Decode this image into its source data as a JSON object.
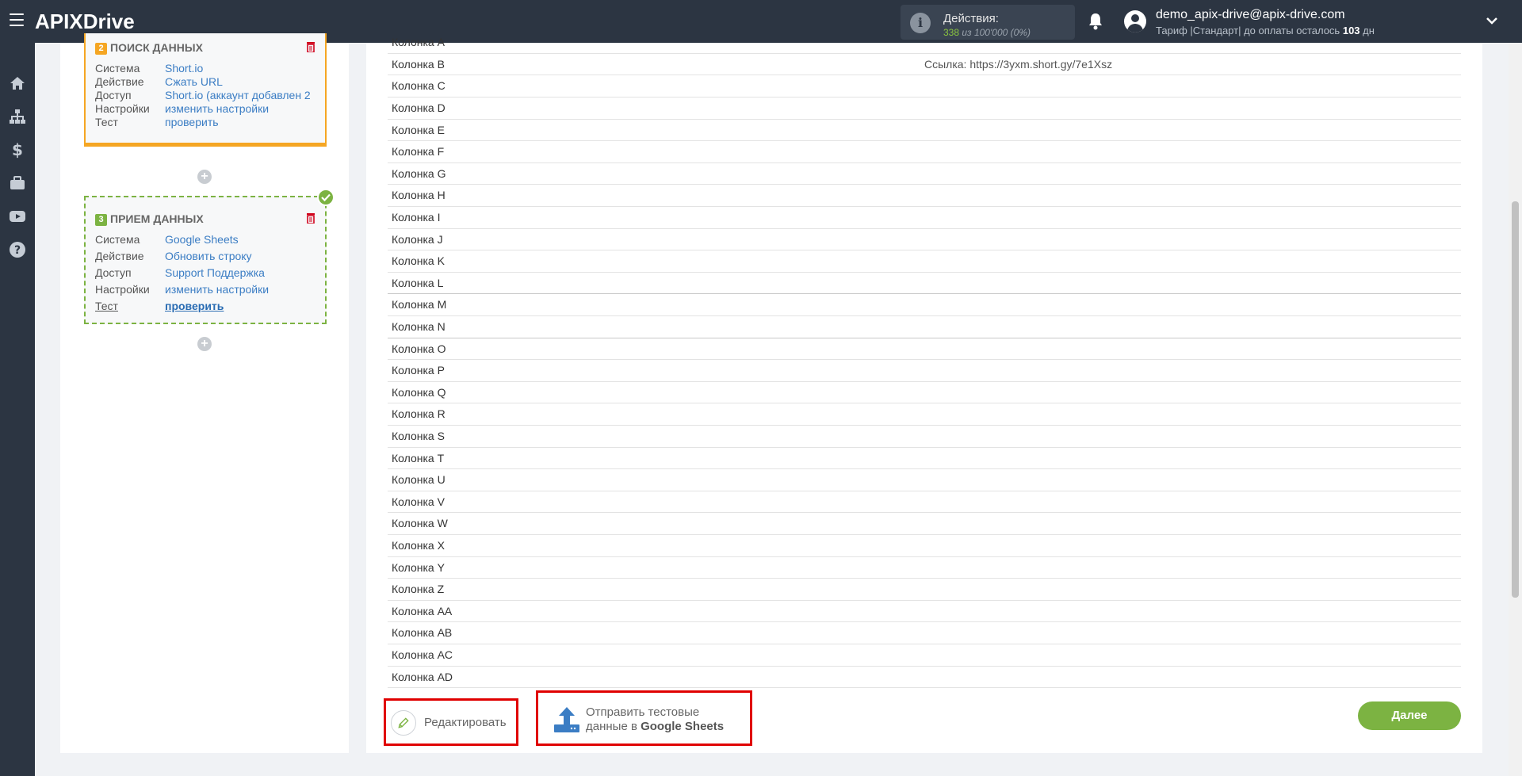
{
  "header": {
    "logo_api": "APIX",
    "logo_drive": "Drive",
    "actions_label": "Действия:",
    "actions_used": "338",
    "actions_rest": "из 100'000 (0%)",
    "user_email": "demo_apix-drive@apix-drive.com",
    "plan_prefix": "Тариф |Стандарт| до оплаты осталось",
    "plan_days": "103",
    "plan_suffix": "дн"
  },
  "sidebar": {
    "icons": [
      "home-icon",
      "sitemap-icon",
      "dollar-icon",
      "briefcase-icon",
      "youtube-icon",
      "help-icon"
    ]
  },
  "search_card": {
    "num": "2",
    "title": "ПОИСК ДАННЫХ",
    "rows": [
      {
        "k": "Система",
        "v": "Short.io"
      },
      {
        "k": "Действие",
        "v": "Сжать URL"
      },
      {
        "k": "Доступ",
        "v": "Short.io (аккаунт добавлен 2"
      },
      {
        "k": "Настройки",
        "v": "изменить настройки"
      },
      {
        "k": "Тест",
        "v": "проверить"
      }
    ]
  },
  "recv_card": {
    "num": "3",
    "title": "ПРИЕМ ДАННЫХ",
    "rows": [
      {
        "k": "Система",
        "v": "Google Sheets"
      },
      {
        "k": "Действие",
        "v": "Обновить строку"
      },
      {
        "k": "Доступ",
        "v": "Support Поддержка"
      },
      {
        "k": "Настройки",
        "v": "изменить настройки"
      },
      {
        "k": "Тест",
        "v": "проверить"
      }
    ]
  },
  "table": {
    "rows": [
      {
        "col": "Колонка A",
        "val": ""
      },
      {
        "col": "Колонка B",
        "val": "Ссылка: https://3yxm.short.gy/7e1Xsz"
      },
      {
        "col": "Колонка C",
        "val": ""
      },
      {
        "col": "Колонка D",
        "val": ""
      },
      {
        "col": "Колонка E",
        "val": ""
      },
      {
        "col": "Колонка F",
        "val": ""
      },
      {
        "col": "Колонка G",
        "val": ""
      },
      {
        "col": "Колонка H",
        "val": ""
      },
      {
        "col": "Колонка I",
        "val": ""
      },
      {
        "col": "Колонка J",
        "val": ""
      },
      {
        "col": "Колонка K",
        "val": ""
      },
      {
        "col": "Колонка L",
        "val": ""
      },
      {
        "col": "Колонка M",
        "val": ""
      },
      {
        "col": "Колонка N",
        "val": ""
      },
      {
        "col": "Колонка O",
        "val": ""
      },
      {
        "col": "Колонка P",
        "val": ""
      },
      {
        "col": "Колонка Q",
        "val": ""
      },
      {
        "col": "Колонка R",
        "val": ""
      },
      {
        "col": "Колонка S",
        "val": ""
      },
      {
        "col": "Колонка T",
        "val": ""
      },
      {
        "col": "Колонка U",
        "val": ""
      },
      {
        "col": "Колонка V",
        "val": ""
      },
      {
        "col": "Колонка W",
        "val": ""
      },
      {
        "col": "Колонка X",
        "val": ""
      },
      {
        "col": "Колонка Y",
        "val": ""
      },
      {
        "col": "Колонка Z",
        "val": ""
      },
      {
        "col": "Колонка AA",
        "val": ""
      },
      {
        "col": "Колонка AB",
        "val": ""
      },
      {
        "col": "Колонка AC",
        "val": ""
      },
      {
        "col": "Колонка AD",
        "val": ""
      }
    ]
  },
  "buttons": {
    "edit": "Редактировать",
    "send_line1": "Отправить тестовые",
    "send_line2_prefix": "данные в",
    "send_line2_bold": "Google Sheets",
    "next": "Далее"
  },
  "colors": {
    "topbar": "#2c3542",
    "accent_green": "#7cb342",
    "accent_orange": "#f5a623",
    "highlight_red": "#e00000",
    "link_blue": "#3b7dc4"
  }
}
